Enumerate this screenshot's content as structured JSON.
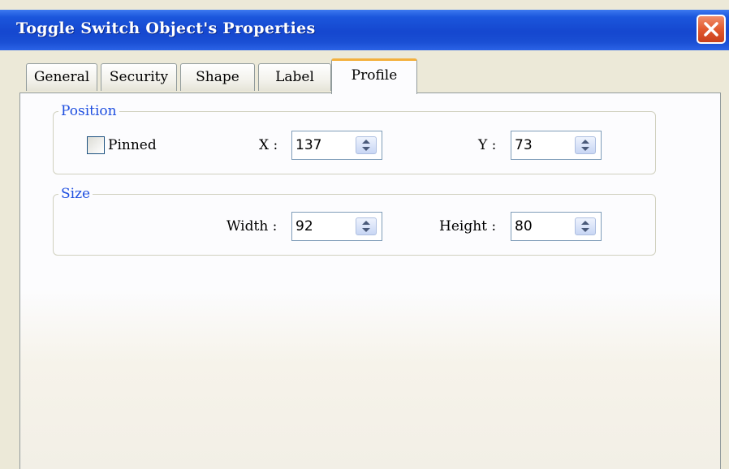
{
  "window": {
    "title": "Toggle Switch Object's Properties"
  },
  "icons": {
    "close": "close-x-icon",
    "spin": "up-down-arrows-icon",
    "checkbox": "checkbox-icon"
  },
  "colors": {
    "titlebar": "#1547cf",
    "group_label": "#1f4fe0",
    "active_tab_highlight": "#f3b03d",
    "close_button": "#e25a2f"
  },
  "tabs": [
    {
      "label": "General",
      "active": false
    },
    {
      "label": "Security",
      "active": false
    },
    {
      "label": "Shape",
      "active": false
    },
    {
      "label": "Label",
      "active": false
    },
    {
      "label": "Profile",
      "active": true
    }
  ],
  "position": {
    "legend": "Position",
    "pinned_label": "Pinned",
    "pinned_checked": false,
    "x_label": "X :",
    "x_value": "137",
    "y_label": "Y :",
    "y_value": "73"
  },
  "size": {
    "legend": "Size",
    "width_label": "Width :",
    "width_value": "92",
    "height_label": "Height :",
    "height_value": "80"
  }
}
